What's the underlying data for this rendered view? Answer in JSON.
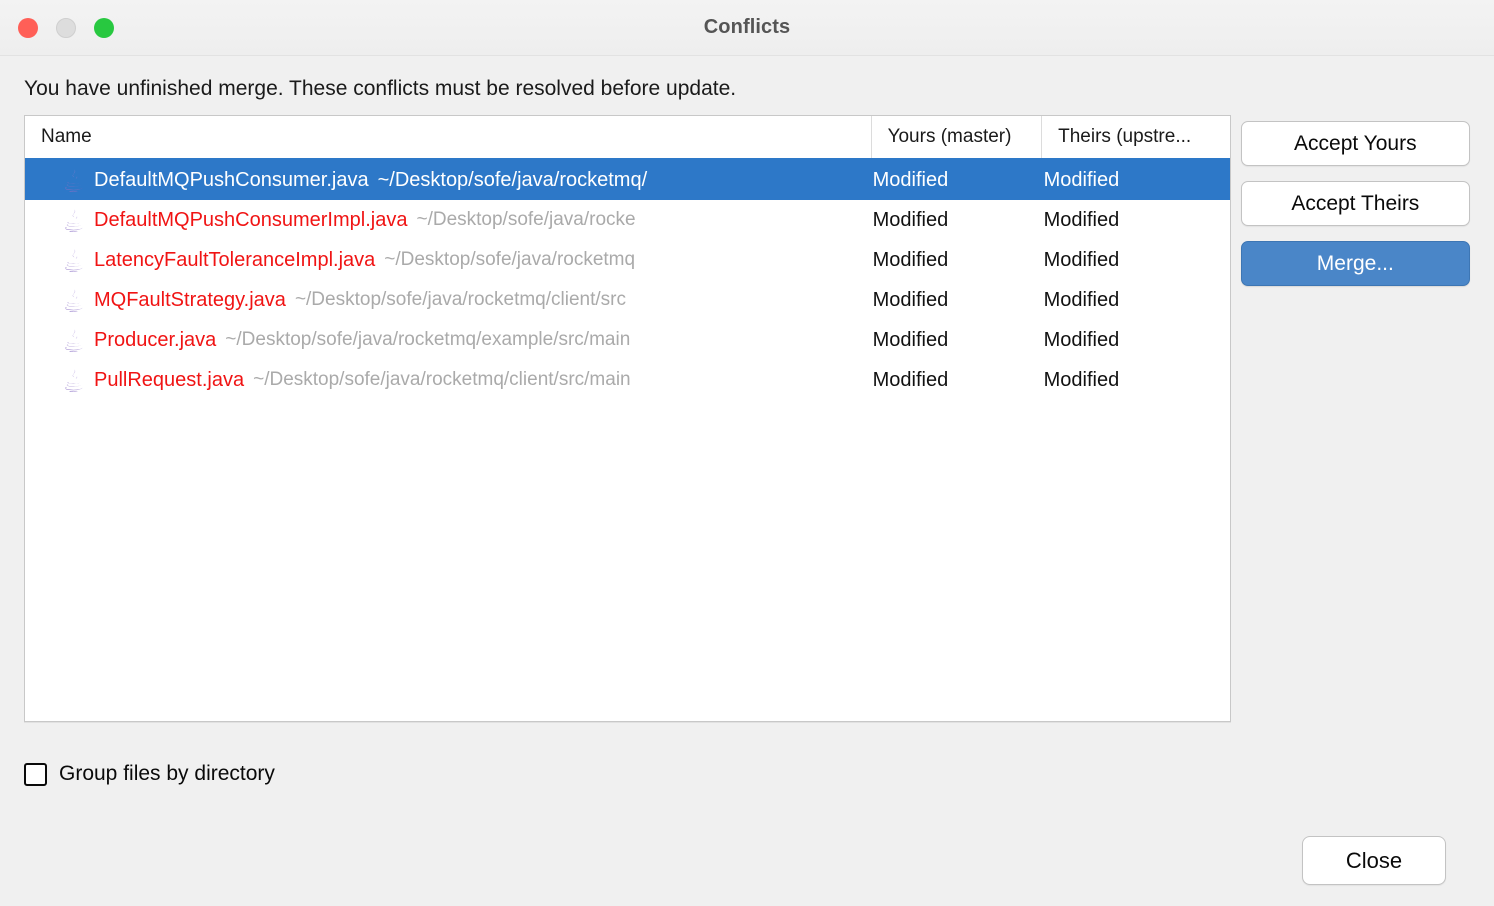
{
  "window": {
    "title": "Conflicts",
    "traffic_lights": [
      "close",
      "minimize",
      "zoom"
    ]
  },
  "description": "You have unfinished merge. These conflicts must be resolved before update.",
  "table": {
    "columns": [
      {
        "key": "name",
        "label": "Name"
      },
      {
        "key": "yours",
        "label": "Yours (master)"
      },
      {
        "key": "theirs",
        "label": "Theirs (upstre..."
      }
    ],
    "rows": [
      {
        "icon": "java-file-icon",
        "filename": "DefaultMQPushConsumer.java",
        "path": "~/Desktop/sofe/java/rocketmq/",
        "yours": "Modified",
        "theirs": "Modified",
        "selected": true
      },
      {
        "icon": "java-file-icon",
        "filename": "DefaultMQPushConsumerImpl.java",
        "path": "~/Desktop/sofe/java/rocke",
        "yours": "Modified",
        "theirs": "Modified",
        "selected": false
      },
      {
        "icon": "java-file-icon",
        "filename": "LatencyFaultToleranceImpl.java",
        "path": "~/Desktop/sofe/java/rocketmq",
        "yours": "Modified",
        "theirs": "Modified",
        "selected": false
      },
      {
        "icon": "java-file-icon",
        "filename": "MQFaultStrategy.java",
        "path": "~/Desktop/sofe/java/rocketmq/client/src",
        "yours": "Modified",
        "theirs": "Modified",
        "selected": false
      },
      {
        "icon": "java-file-icon",
        "filename": "Producer.java",
        "path": "~/Desktop/sofe/java/rocketmq/example/src/main",
        "yours": "Modified",
        "theirs": "Modified",
        "selected": false
      },
      {
        "icon": "java-file-icon",
        "filename": "PullRequest.java",
        "path": "~/Desktop/sofe/java/rocketmq/client/src/main",
        "yours": "Modified",
        "theirs": "Modified",
        "selected": false
      }
    ]
  },
  "side_buttons": {
    "accept_yours": "Accept Yours",
    "accept_theirs": "Accept Theirs",
    "merge": "Merge..."
  },
  "footer": {
    "group_by_directory_label": "Group files by directory",
    "group_by_directory_checked": false,
    "close": "Close"
  },
  "colors": {
    "selection_blue": "#2d78c8",
    "primary_button_blue": "#4a86c8",
    "conflict_red": "#f01414",
    "path_grey": "#aaaaaa",
    "window_background": "#f0f0f0",
    "traffic_close": "#ff5f57",
    "traffic_min": "#dddddd",
    "traffic_zoom": "#28c840"
  }
}
